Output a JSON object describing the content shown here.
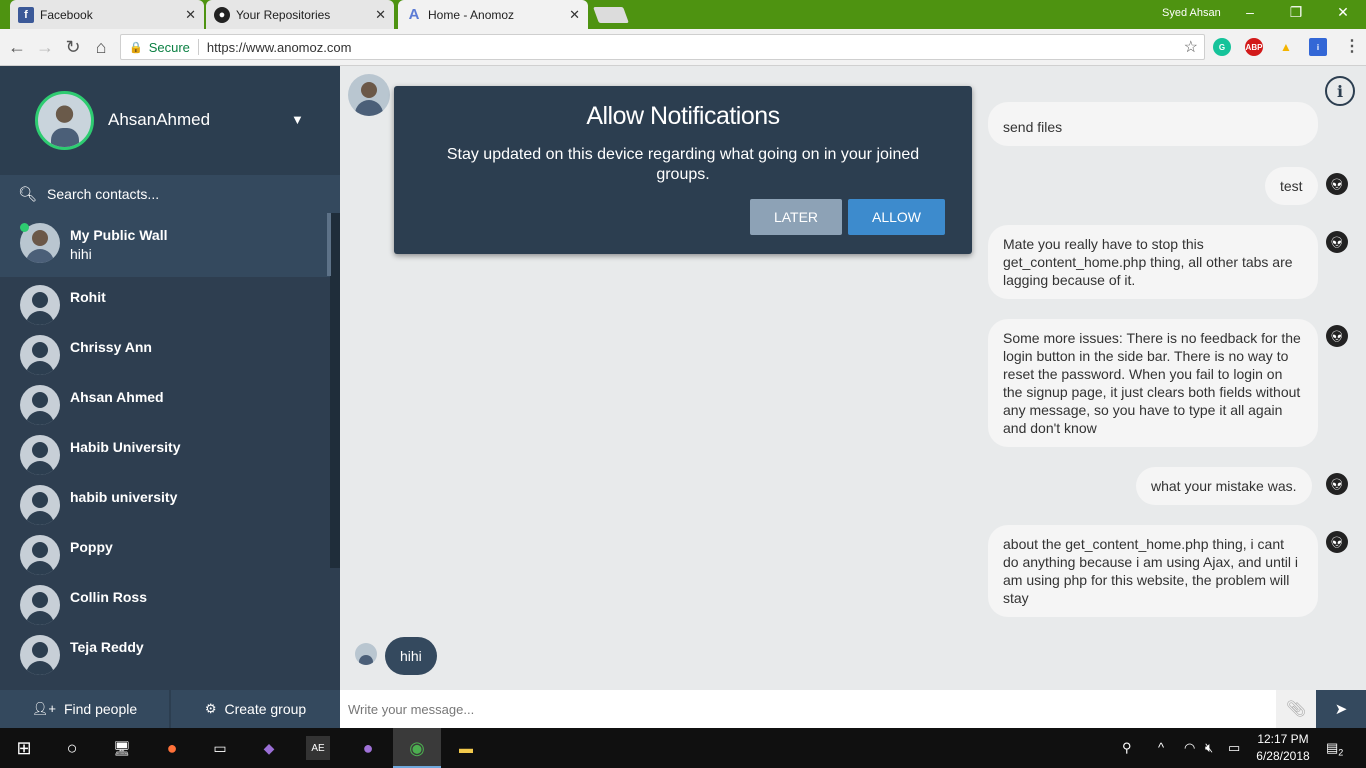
{
  "browser": {
    "tabs": [
      {
        "title": "Facebook",
        "icon": "facebook-icon"
      },
      {
        "title": "Your Repositories",
        "icon": "github-icon"
      },
      {
        "title": "Home - Anomoz",
        "icon": "anomoz-icon"
      }
    ],
    "user": "Syed Ahsan",
    "secure_label": "Secure",
    "url": "https://www.anomoz.com",
    "extensions": [
      "grammarly-icon",
      "adblock-plus-icon",
      "google-drive-icon",
      "extension-icon"
    ],
    "adblock_label": "ABP"
  },
  "sidebar": {
    "profile_name": "AhsanAhmed",
    "search_placeholder": "Search contacts...",
    "contacts": [
      {
        "name": "My Public Wall",
        "subtitle": "hihi"
      },
      {
        "name": "Rohit"
      },
      {
        "name": "Chrissy Ann"
      },
      {
        "name": "Ahsan Ahmed"
      },
      {
        "name": "Habib University"
      },
      {
        "name": "habib university"
      },
      {
        "name": "Poppy"
      },
      {
        "name": "Collin Ross"
      },
      {
        "name": "Teja Reddy"
      }
    ],
    "find_people_label": "Find people",
    "create_group_label": "Create group"
  },
  "chat": {
    "messages": [
      {
        "text": "send files"
      },
      {
        "text": "test"
      },
      {
        "text": "Mate you really have to stop this get_content_home.php thing, all other tabs are lagging because of it."
      },
      {
        "text": "Some more issues: There is no feedback for the login button in the side bar. There is no way to reset the password. When you fail to login on the signup page, it just clears both fields without any message, so you have to type it all again and don't know"
      },
      {
        "text": "what your mistake was."
      },
      {
        "text": "about the get_content_home.php thing, i cant do anything because i am using Ajax, and until i am using php for this website, the problem will stay"
      }
    ],
    "my_message": "hihi",
    "composer_placeholder": "Write your message..."
  },
  "modal": {
    "title": "Allow Notifications",
    "body": "Stay updated on this device regarding what going on in your joined groups.",
    "later_label": "LATER",
    "allow_label": "ALLOW"
  },
  "taskbar": {
    "time": "12:17 PM",
    "date": "6/28/2018",
    "notification_count": "2"
  },
  "colors": {
    "tabstrip": "#4e9311",
    "sidebar": "#2e3e50",
    "accent_blue": "#3d8bcd",
    "online_green": "#2ecc71"
  }
}
